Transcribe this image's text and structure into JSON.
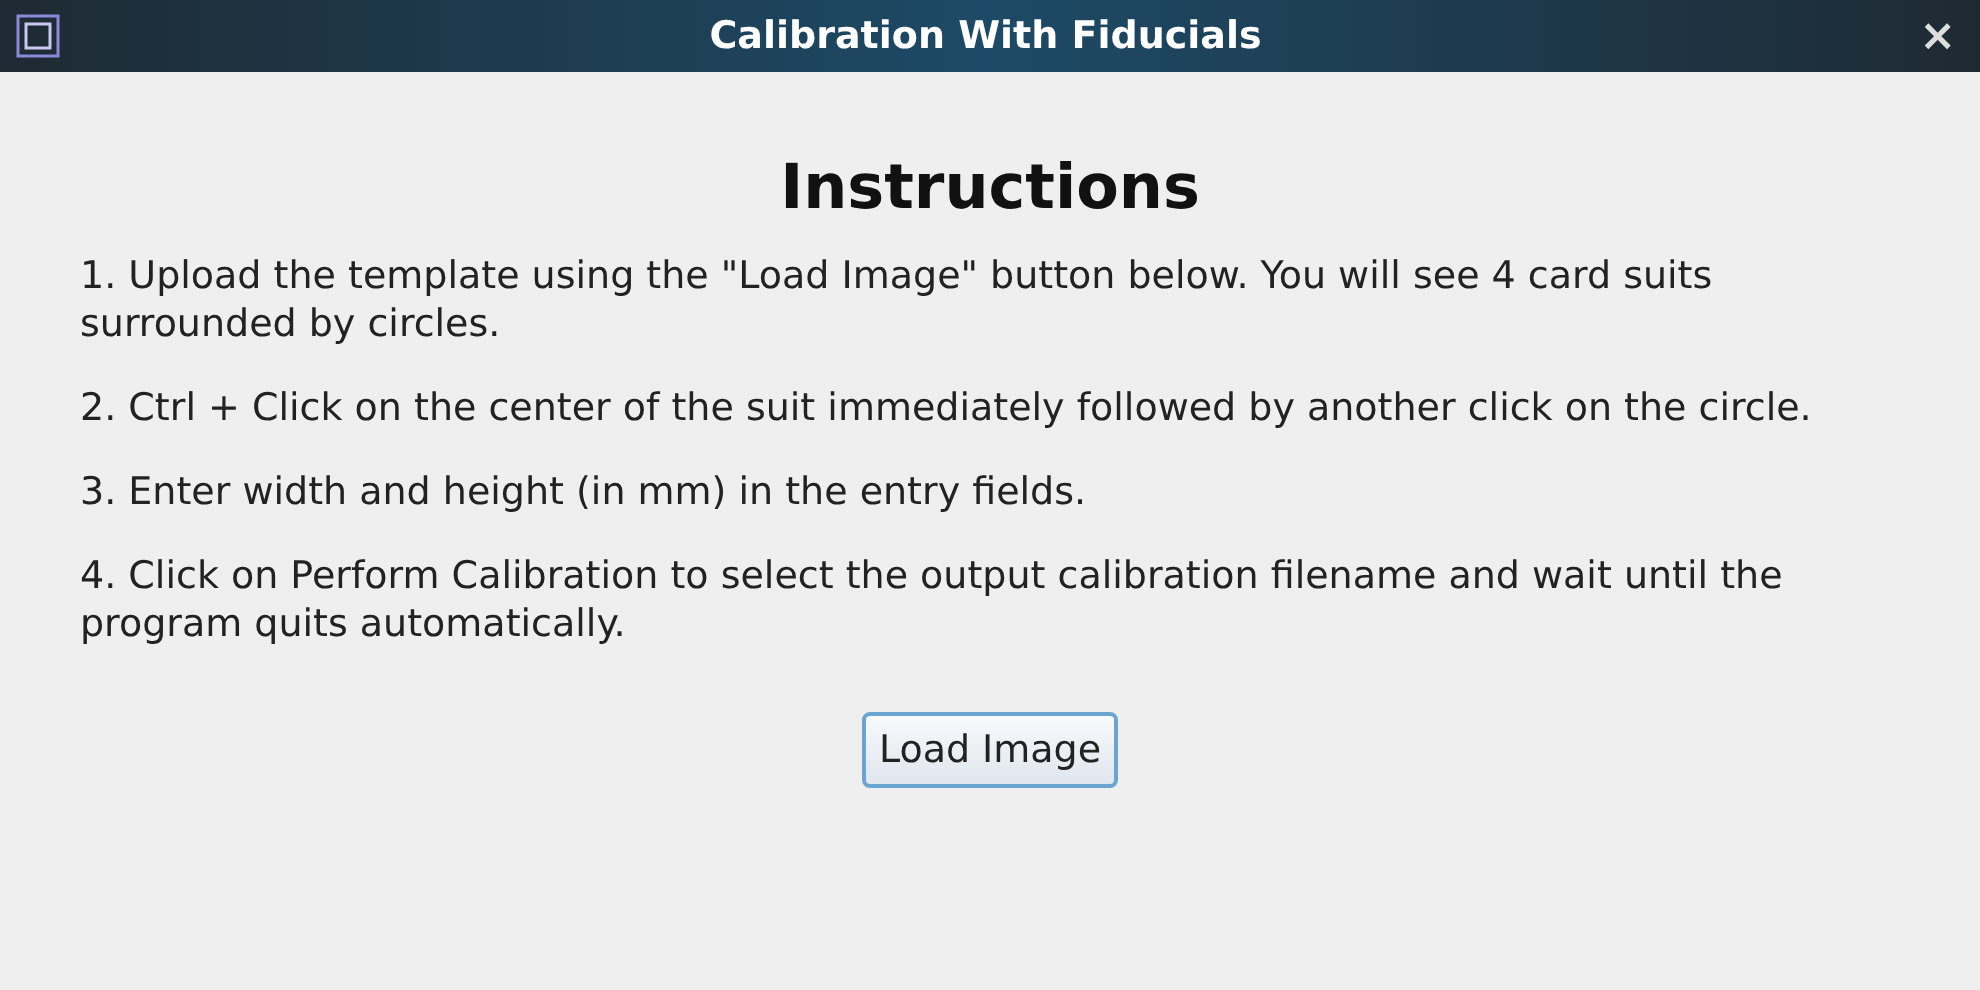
{
  "window": {
    "title": "Calibration With Fiducials",
    "close": "×"
  },
  "heading": "Instructions",
  "steps": [
    "1. Upload the template using the \"Load Image\" button below. You will see 4 card suits surrounded by circles.",
    "2. Ctrl + Click on the center of the suit immediately followed by another click on the circle.",
    "3. Enter width and height (in mm) in the entry fields.",
    "4. Click on Perform Calibration to select the output calibration filename and wait until the program quits automatically."
  ],
  "buttons": [
    "Load Image"
  ]
}
